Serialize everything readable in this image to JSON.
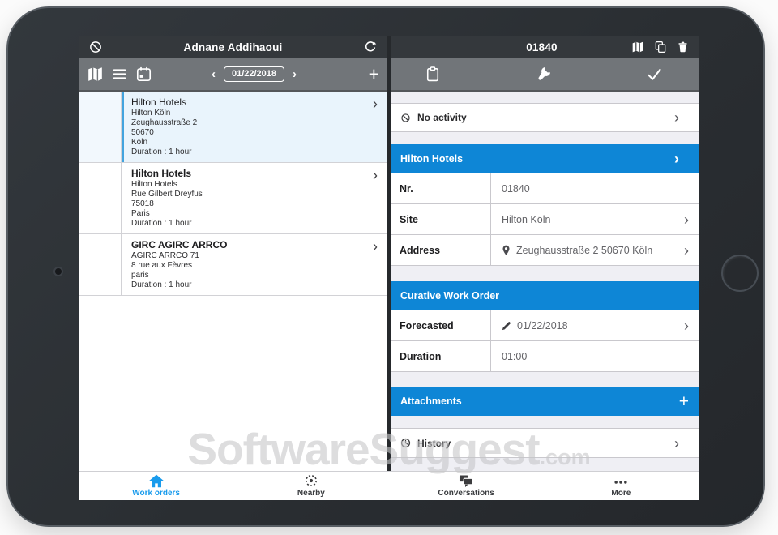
{
  "colors": {
    "accent_blue": "#0e86d6",
    "tab_active_blue": "#199bec",
    "dark_bar": "#34383c",
    "toolbar_gray": "#717579",
    "selected_item_bg": "#e9f4fc",
    "selected_item_border": "#41a3de"
  },
  "left_panel": {
    "header": {
      "title": "Adnane Addihaoui"
    },
    "toolbar": {
      "prev": "‹",
      "date": "01/22/2018",
      "next": "›",
      "add": "+"
    },
    "work_orders": [
      {
        "title": "Hilton Hotels",
        "selected": true,
        "lines": [
          "Hilton Köln",
          "Zeughausstraße 2",
          "50670",
          "Köln",
          "Duration : 1 hour"
        ]
      },
      {
        "title": "Hilton Hotels",
        "selected": false,
        "lines": [
          "Hilton Hotels",
          "Rue Gilbert Dreyfus",
          "75018",
          "Paris",
          "Duration : 1 hour"
        ]
      },
      {
        "title": "GIRC AGIRC ARRCO",
        "selected": false,
        "lines": [
          "AGIRC ARRCO 71",
          "8 rue aux Fèvres",
          "paris",
          "Duration : 1 hour"
        ]
      }
    ]
  },
  "right_panel": {
    "header": {
      "title": "01840"
    },
    "activity_row": {
      "label": "No activity"
    },
    "sections": [
      {
        "header": "Hilton Hotels",
        "rows": [
          {
            "label": "Nr.",
            "value": "01840"
          },
          {
            "label": "Site",
            "value": "Hilton Köln"
          },
          {
            "label": "Address",
            "value": "Zeughausstraße 2 50670 Köln"
          }
        ]
      },
      {
        "header": "Curative Work Order",
        "rows": [
          {
            "label": "Forecasted",
            "value": "01/22/2018"
          },
          {
            "label": "Duration",
            "value": "01:00"
          }
        ]
      },
      {
        "header": "Attachments",
        "action": "+"
      }
    ],
    "history_row": {
      "label": "History"
    }
  },
  "tab_bar": [
    {
      "label": "Work orders",
      "active": true
    },
    {
      "label": "Nearby",
      "active": false
    },
    {
      "label": "Conversations",
      "active": false
    },
    {
      "label": "More",
      "active": false
    }
  ],
  "watermark": {
    "text": "SoftwareSuggest",
    "suffix": ".com"
  },
  "symbols": {
    "chevron": "›"
  }
}
